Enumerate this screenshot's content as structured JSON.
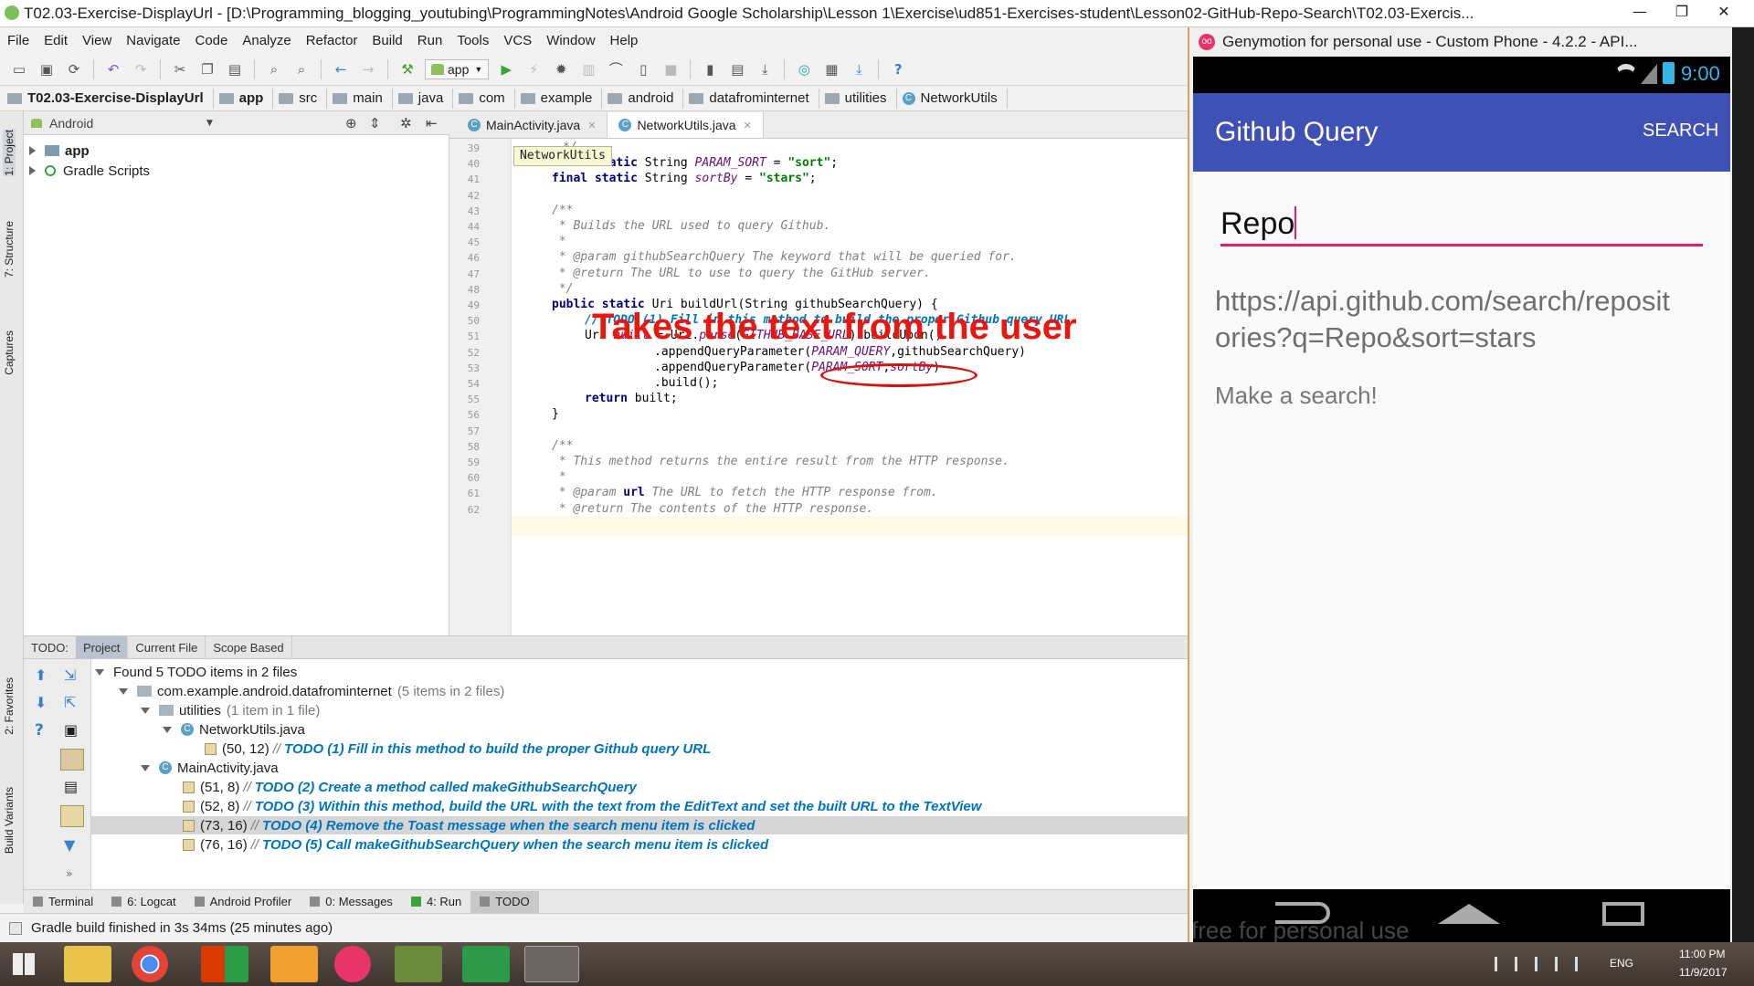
{
  "window": {
    "title": "T02.03-Exercise-DisplayUrl - [D:\\Programming_blogging_youtubing\\ProgrammingNotes\\Android Google Scholarship\\Lesson 1\\Exercise\\ud851-Exercises-student\\Lesson02-GitHub-Repo-Search\\T02.03-Exercis...",
    "minimize": "—",
    "maximize": "❐",
    "close": "✕"
  },
  "menu": [
    "File",
    "Edit",
    "View",
    "Navigate",
    "Code",
    "Analyze",
    "Refactor",
    "Build",
    "Run",
    "Tools",
    "VCS",
    "Window",
    "Help"
  ],
  "toolbar": {
    "config": "app"
  },
  "breadcrumb": [
    "T02.03-Exercise-DisplayUrl",
    "app",
    "src",
    "main",
    "java",
    "com",
    "example",
    "android",
    "datafrominternet",
    "utilities",
    "NetworkUtils"
  ],
  "side_tabs": {
    "project": "1: Project",
    "structure": "7: Structure",
    "captures": "Captures",
    "favorites": "2: Favorites",
    "build_variants": "Build Variants"
  },
  "project_panel": {
    "view": "Android",
    "items": [
      {
        "label": "app",
        "icon": "module-folder-icon"
      },
      {
        "label": "Gradle Scripts",
        "icon": "gradle-icon"
      }
    ]
  },
  "editor": {
    "tabs": [
      {
        "label": "MainActivity.java",
        "active": false
      },
      {
        "label": "NetworkUtils.java",
        "active": true
      }
    ],
    "hint": "NetworkUtils",
    "line_numbers": [
      "39",
      "40",
      "41",
      "42",
      "43",
      "44",
      "45",
      "46",
      "47",
      "48",
      "49",
      "50",
      "51",
      "52",
      "53",
      "54",
      "55",
      "56",
      "57",
      "58",
      "59",
      "60",
      "61",
      "62"
    ],
    "code": {
      "l39": "*/",
      "l40_kw": "final static",
      "l40_type": " String ",
      "l40_field": "PARAM_SORT",
      "l40_eq": " = ",
      "l40_str": "\"sort\"",
      "l40_end": ";",
      "l41_kw": "final static",
      "l41_type": " String ",
      "l41_field": "sortBy",
      "l41_eq": " = ",
      "l41_str": "\"stars\"",
      "l41_end": ";",
      "l43": "/**",
      "l44": " * Builds the URL used to query Github.",
      "l45": " *",
      "l46": " * @param githubSearchQuery The keyword that will be queried for.",
      "l47": " * @return The URL to use to query the GitHub server.",
      "l48": " */",
      "l49_kw": "public static",
      "l49_rest": " Uri buildUrl(String githubSearchQuery) {",
      "l50": "// TODO (1) Fill in this method to build the proper Github query URL",
      "l51_a": "Uri ",
      "l51_b": "built",
      "l51_c": " = Uri.",
      "l51_d": "parse",
      "l51_e": "(",
      "l51_f": "GITHUB_BASE_URL",
      "l51_g": ").buildUpon()",
      "l52_a": ".appendQueryParameter(",
      "l52_b": "PARAM_QUERY",
      "l52_c": ",githubSearchQuery)",
      "l53_a": ".appendQueryParameter(",
      "l53_b": "PARAM_SORT",
      "l53_c": ",",
      "l53_d": "sortBy",
      "l53_e": ")",
      "l54": ".build();",
      "l55_kw": "return",
      "l55_rest": " built;",
      "l56": "}",
      "l58": "/**",
      "l59": " * This method returns the entire result from the HTTP response.",
      "l60": " *",
      "l61_a": " * @param",
      "l61_b": " url",
      "l61_c": " The URL to fetch the HTTP response from.",
      "l62_a": " * @return",
      "l62_b": " The contents of the HTTP response."
    },
    "annotation": "Takes the text from the user"
  },
  "todo_panel": {
    "label": "TODO:",
    "tabs": [
      {
        "label": "Project",
        "active": true
      },
      {
        "label": "Current File",
        "active": false
      },
      {
        "label": "Scope Based",
        "active": false
      }
    ],
    "summary": "Found 5 TODO items in 2 files",
    "package": "com.example.android.datafrominternet",
    "package_count": "(5 items in 2 files)",
    "utilities": "utilities",
    "utilities_count": "(1 item in 1 file)",
    "file1": "NetworkUtils.java",
    "file2": "MainActivity.java",
    "items": [
      {
        "pos": "(50, 12)",
        "prefix": "//",
        "text": "TODO (1) Fill in this method to build the proper Github query URL"
      },
      {
        "pos": "(51, 8)",
        "prefix": "//",
        "text": "TODO (2) Create a method called makeGithubSearchQuery"
      },
      {
        "pos": "(52, 8)",
        "prefix": "//",
        "text": "TODO (3) Within this method, build the URL with the text from the EditText and set the built URL to the TextView"
      },
      {
        "pos": "(73, 16)",
        "prefix": "//",
        "text": "TODO (4) Remove the Toast message when the search menu item is clicked"
      },
      {
        "pos": "(76, 16)",
        "prefix": "//",
        "text": "TODO (5) Call makeGithubSearchQuery when the search menu item is clicked"
      }
    ]
  },
  "bottom_tabs": [
    {
      "label": "Terminal",
      "icon": "terminal-icon"
    },
    {
      "label": "6: Logcat",
      "icon": "logcat-icon"
    },
    {
      "label": "Android Profiler",
      "icon": "profiler-icon"
    },
    {
      "label": "0: Messages",
      "icon": "messages-icon"
    },
    {
      "label": "4: Run",
      "icon": "run-icon"
    },
    {
      "label": "TODO",
      "icon": "todo-icon",
      "active": true
    }
  ],
  "status": "Gradle build finished in 3s 34ms (25 minutes ago)",
  "genymotion": {
    "title": "Genymotion for personal use - Custom Phone - 4.2.2 - API...",
    "time": "9:00",
    "app_title": "Github Query",
    "action": "SEARCH",
    "input_value": "Repo",
    "url_text": "https://api.github.com/search/repositories?q=Repo&sort=stars",
    "result_text": "Make a search!",
    "watermark": "free for personal use"
  },
  "taskbar": {
    "lang": "ENG",
    "time": "11:00 PM",
    "date": "11/9/2017"
  },
  "colors": {
    "accent": "#3f51b5",
    "annotation": "#e8170f",
    "todo": "#0073bf",
    "input_underline": "#e91e63"
  }
}
